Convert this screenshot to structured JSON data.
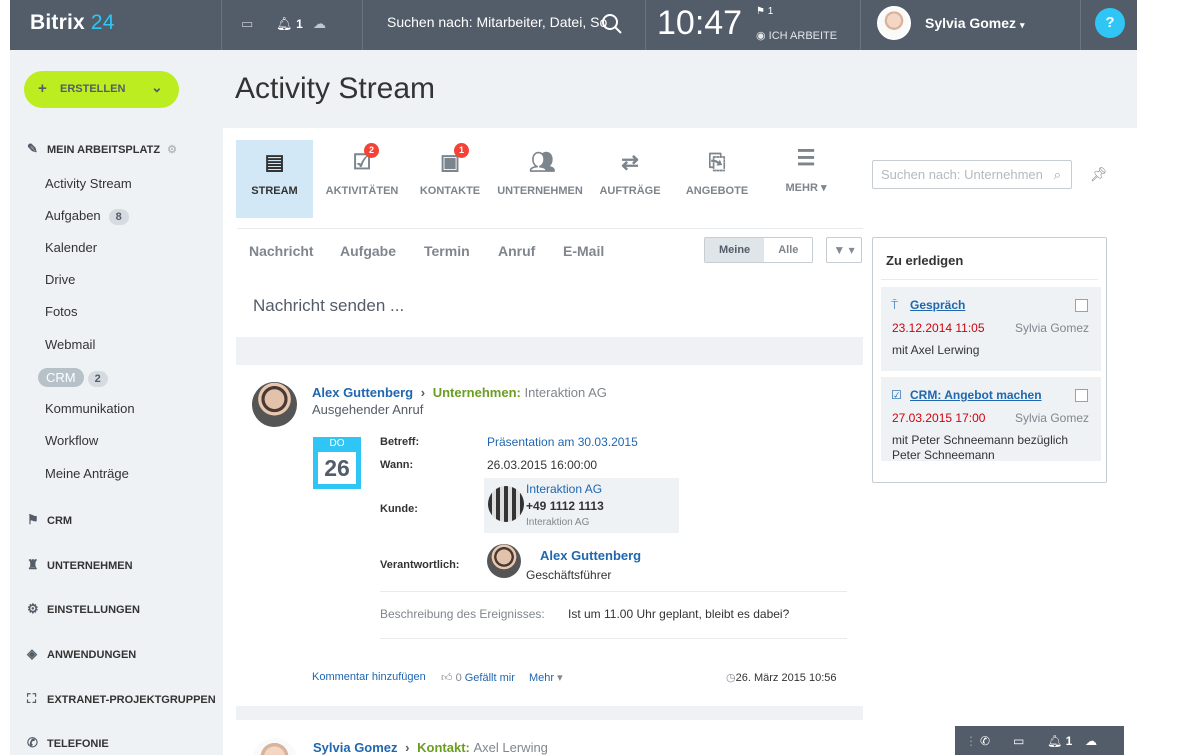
{
  "header": {
    "logo": "Bitrix",
    "logo_num": "24",
    "notif_count": "1",
    "search_placeholder": "Suchen nach: Mitarbeiter, Datei, So",
    "time": "10:47",
    "flag_count": "1",
    "work_status": "ICH ARBEITE",
    "user_name": "Sylvia Gomez",
    "help": "?"
  },
  "sidebar": {
    "create": "ERSTELLEN",
    "my_workspace": "MEIN ARBEITSPLATZ",
    "items": [
      {
        "label": "Activity Stream",
        "count": ""
      },
      {
        "label": "Aufgaben",
        "count": "8"
      },
      {
        "label": "Kalender",
        "count": ""
      },
      {
        "label": "Drive",
        "count": ""
      },
      {
        "label": "Fotos",
        "count": ""
      },
      {
        "label": "Webmail",
        "count": ""
      },
      {
        "label": "CRM",
        "count": "2"
      },
      {
        "label": "Kommunikation",
        "count": ""
      },
      {
        "label": "Workflow",
        "count": ""
      },
      {
        "label": "Meine Anträge",
        "count": ""
      }
    ],
    "sections": [
      "CRM",
      "UNTERNEHMEN",
      "EINSTELLUNGEN",
      "ANWENDUNGEN",
      "EXTRANET-PROJEKTGRUPPEN",
      "TELEFONIE"
    ]
  },
  "page_title": "Activity Stream",
  "tabs": [
    {
      "label": "STREAM",
      "badge": ""
    },
    {
      "label": "AKTIVITÄTEN",
      "badge": "2"
    },
    {
      "label": "KONTAKTE",
      "badge": "1"
    },
    {
      "label": "UNTERNEHMEN",
      "badge": ""
    },
    {
      "label": "AUFTRÄGE",
      "badge": ""
    },
    {
      "label": "ANGEBOTE",
      "badge": ""
    },
    {
      "label": "MEHR",
      "badge": ""
    }
  ],
  "right_search_placeholder": "Suchen nach: Unternehmen",
  "post_tabs": [
    "Nachricht",
    "Aufgabe",
    "Termin",
    "Anruf",
    "E-Mail"
  ],
  "switch": {
    "mine": "Meine",
    "all": "Alle"
  },
  "composer": "Nachricht senden ...",
  "post": {
    "author": "Alex Guttenberg",
    "target_label": "Unternehmen:",
    "target_value": "Interaktion AG",
    "type": "Ausgehender Anruf",
    "cal_day": "DO",
    "cal_num": "26",
    "subject_label": "Betreff:",
    "subject": "Präsentation am 30.03.2015",
    "when_label": "Wann:",
    "when": "26.03.2015 16:00:00",
    "client_label": "Kunde:",
    "client_name": "Interaktion AG",
    "client_phone": "+49 1112 1113",
    "client_company": "Interaktion AG",
    "resp_label": "Verantwortlich:",
    "resp_name": "Alex Guttenberg",
    "resp_role": "Geschäftsführer",
    "desc_label": "Beschreibung des Ereignisses:",
    "desc": "Ist um 11.00 Uhr geplant, bleibt es dabei?",
    "comment": "Kommentar hinzufügen",
    "likes": "0",
    "like": "Gefällt mir",
    "more": "Mehr",
    "date": "26. März 2015 10:56"
  },
  "post2": {
    "author": "Sylvia Gomez",
    "target_label": "Kontakt:",
    "target_value": "Axel Lerwing"
  },
  "todo": {
    "title": "Zu erledigen",
    "items": [
      {
        "title": "Gespräch",
        "date": "23.12.2014 11:05",
        "user": "Sylvia Gomez",
        "desc": "mit Axel Lerwing"
      },
      {
        "title": "CRM: Angebot machen",
        "date": "27.03.2015 17:00",
        "user": "Sylvia Gomez",
        "desc": "mit Peter Schneemann bezüglich Peter Schneemann"
      }
    ]
  },
  "bottom_bar": {
    "notif": "1"
  },
  "colors": {
    "header": "#535c69",
    "accent": "#2fc6f6",
    "create": "#bbed21",
    "link": "#2067b0",
    "badge": "#f44336"
  }
}
